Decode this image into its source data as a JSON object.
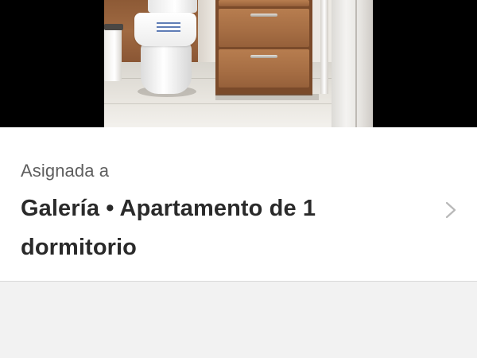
{
  "photo": {
    "subject": "bathroom"
  },
  "assignment": {
    "label": "Asignada a",
    "value": "Galería • Apartamento de 1 dormitorio"
  },
  "icons": {
    "chevron": "chevron-right-icon"
  },
  "colors": {
    "background": "#f2f2f2",
    "card": "#ffffff",
    "label_text": "#5e5e5e",
    "value_text": "#2a2a2a",
    "chevron": "#b8b8b8"
  }
}
